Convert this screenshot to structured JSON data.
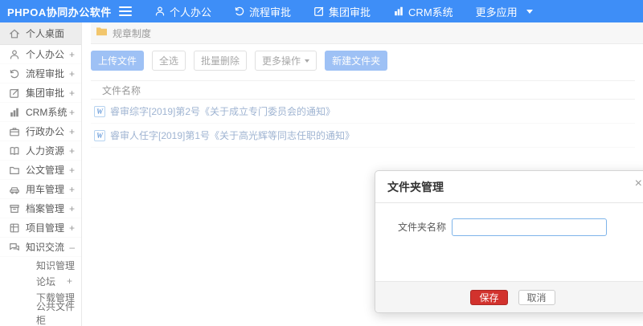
{
  "navbar": {
    "logo": "PHPOA协同办公软件",
    "items": [
      {
        "label": "个人办公",
        "icon": "user-icon"
      },
      {
        "label": "流程审批",
        "icon": "history-icon"
      },
      {
        "label": "集团审批",
        "icon": "edit-icon"
      },
      {
        "label": "CRM系统",
        "icon": "bar-chart-icon"
      },
      {
        "label": "更多应用",
        "icon": "caret-down-icon"
      }
    ]
  },
  "sidebar": {
    "items": [
      {
        "label": "个人桌面",
        "icon": "home-icon",
        "toggle": ""
      },
      {
        "label": "个人办公",
        "icon": "user-icon",
        "toggle": "+"
      },
      {
        "label": "流程审批",
        "icon": "history-icon",
        "toggle": "+"
      },
      {
        "label": "集团审批",
        "icon": "edit-icon",
        "toggle": "+"
      },
      {
        "label": "CRM系统",
        "icon": "bar-chart-icon",
        "toggle": "+"
      },
      {
        "label": "行政办公",
        "icon": "briefcase-icon",
        "toggle": "+"
      },
      {
        "label": "人力资源",
        "icon": "book-icon",
        "toggle": "+"
      },
      {
        "label": "公文管理",
        "icon": "folder-icon",
        "toggle": "+"
      },
      {
        "label": "用车管理",
        "icon": "car-icon",
        "toggle": "+"
      },
      {
        "label": "档案管理",
        "icon": "archive-icon",
        "toggle": "+"
      },
      {
        "label": "项目管理",
        "icon": "grid-icon",
        "toggle": "+"
      },
      {
        "label": "知识交流",
        "icon": "chat-icon",
        "toggle": "–"
      }
    ],
    "subitems": [
      {
        "label": "知识管理",
        "toggle": ""
      },
      {
        "label": "论坛",
        "toggle": "+"
      },
      {
        "label": "下载管理",
        "toggle": ""
      },
      {
        "label": "公共文件柜",
        "toggle": ""
      }
    ]
  },
  "breadcrumb": {
    "label": "规章制度"
  },
  "toolbar": {
    "upload": "上传文件",
    "select_all": "全选",
    "batch_delete": "批量删除",
    "more_actions": "更多操作",
    "new_folder": "新建文件夹"
  },
  "table": {
    "header": "文件名称",
    "rows": [
      {
        "icon": "word-doc-icon",
        "name": "睿审综字[2019]第2号《关于成立专门委员会的通知》"
      },
      {
        "icon": "word-doc-icon",
        "name": "睿审人任字[2019]第1号《关于高光辉等同志任职的通知》"
      }
    ]
  },
  "modal": {
    "title": "文件夹管理",
    "close": "×",
    "field_label": "文件夹名称",
    "field_value": "",
    "save": "保存",
    "cancel": "取消"
  },
  "colors": {
    "navbar_blue": "#3e8ef7",
    "primary_button": "#9ec1f5",
    "save_red": "#d2322d",
    "link_blue": "#9fb4d2",
    "folder_yellow": "#f2c66d",
    "active_item_bg": "#ededed"
  }
}
